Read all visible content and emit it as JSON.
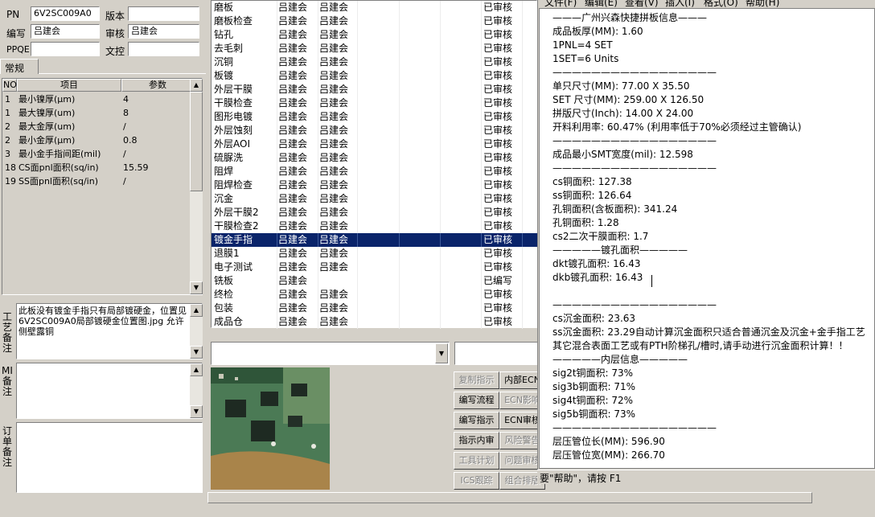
{
  "header": {
    "pn_label": "PN",
    "pn_value": "6V2SC009A0",
    "version_label": "版本",
    "version_value": "",
    "author_label": "编写",
    "author_value": "吕建会",
    "review_label": "审核",
    "review_value": "吕建会",
    "ppqe_label": "PPQE",
    "ppqe_value": "",
    "doc_label": "文控",
    "doc_value": ""
  },
  "tab": {
    "label": "常规"
  },
  "params": {
    "col_no": "NO",
    "col_item": "项目",
    "col_value": "参数",
    "rows": [
      {
        "no": "1",
        "item": "最小镍厚(μm)",
        "value": "4"
      },
      {
        "no": "1",
        "item": "最大镍厚(um)",
        "value": "8"
      },
      {
        "no": "2",
        "item": "最大金厚(um)",
        "value": "/"
      },
      {
        "no": "2",
        "item": "最小金厚(μm)",
        "value": "0.8"
      },
      {
        "no": "3",
        "item": "最小金手指间距(mil)",
        "value": "/"
      },
      {
        "no": "18",
        "item": "CS面pnl面积(sq/in)",
        "value": "15.59"
      },
      {
        "no": "19",
        "item": "SS面pnl面积(sq/in)",
        "value": "/"
      }
    ]
  },
  "notes": {
    "process_label": "工艺备注",
    "process_text": "此板没有镀金手指只有局部镀硬金，位置见6V2SC009A0局部镀硬金位置图.jpg 允许侧壁露铜",
    "mi_label": "MI备注",
    "mi_text": "",
    "order_label": "订单备注",
    "order_text": ""
  },
  "process": {
    "rows": [
      {
        "name": "磨板",
        "writer": "吕建会",
        "reviewer": "吕建会",
        "status": "已审核",
        "selected": false
      },
      {
        "name": "磨板检查",
        "writer": "吕建会",
        "reviewer": "吕建会",
        "status": "已审核",
        "selected": false
      },
      {
        "name": "钻孔",
        "writer": "吕建会",
        "reviewer": "吕建会",
        "status": "已审核",
        "selected": false
      },
      {
        "name": "去毛刺",
        "writer": "吕建会",
        "reviewer": "吕建会",
        "status": "已审核",
        "selected": false
      },
      {
        "name": "沉铜",
        "writer": "吕建会",
        "reviewer": "吕建会",
        "status": "已审核",
        "selected": false
      },
      {
        "name": "板镀",
        "writer": "吕建会",
        "reviewer": "吕建会",
        "status": "已审核",
        "selected": false
      },
      {
        "name": "外层干膜",
        "writer": "吕建会",
        "reviewer": "吕建会",
        "status": "已审核",
        "selected": false
      },
      {
        "name": "干膜检查",
        "writer": "吕建会",
        "reviewer": "吕建会",
        "status": "已审核",
        "selected": false
      },
      {
        "name": "图形电镀",
        "writer": "吕建会",
        "reviewer": "吕建会",
        "status": "已审核",
        "selected": false
      },
      {
        "name": "外层蚀刻",
        "writer": "吕建会",
        "reviewer": "吕建会",
        "status": "已审核",
        "selected": false
      },
      {
        "name": "外层AOI",
        "writer": "吕建会",
        "reviewer": "吕建会",
        "status": "已审核",
        "selected": false
      },
      {
        "name": "硫脲洗",
        "writer": "吕建会",
        "reviewer": "吕建会",
        "status": "已审核",
        "selected": false
      },
      {
        "name": "阻焊",
        "writer": "吕建会",
        "reviewer": "吕建会",
        "status": "已审核",
        "selected": false
      },
      {
        "name": "阻焊检查",
        "writer": "吕建会",
        "reviewer": "吕建会",
        "status": "已审核",
        "selected": false
      },
      {
        "name": "沉金",
        "writer": "吕建会",
        "reviewer": "吕建会",
        "status": "已审核",
        "selected": false
      },
      {
        "name": "外层干膜2",
        "writer": "吕建会",
        "reviewer": "吕建会",
        "status": "已审核",
        "selected": false
      },
      {
        "name": "干膜检查2",
        "writer": "吕建会",
        "reviewer": "吕建会",
        "status": "已审核",
        "selected": false
      },
      {
        "name": "镀金手指",
        "writer": "吕建会",
        "reviewer": "吕建会",
        "status": "已审核",
        "selected": true
      },
      {
        "name": "退膜1",
        "writer": "吕建会",
        "reviewer": "吕建会",
        "status": "已审核",
        "selected": false
      },
      {
        "name": "电子测试",
        "writer": "吕建会",
        "reviewer": "吕建会",
        "status": "已审核",
        "selected": false
      },
      {
        "name": "铣板",
        "writer": "吕建会",
        "reviewer": "",
        "status": "已编写",
        "selected": false
      },
      {
        "name": "终检",
        "writer": "吕建会",
        "reviewer": "吕建会",
        "status": "已审核",
        "selected": false
      },
      {
        "name": "包装",
        "writer": "吕建会",
        "reviewer": "吕建会",
        "status": "已审核",
        "selected": false
      },
      {
        "name": "成品仓",
        "writer": "吕建会",
        "reviewer": "吕建会",
        "status": "已审核",
        "selected": false
      }
    ]
  },
  "buttons": {
    "b1": "复制指示",
    "b2": "内部ECN",
    "b3": "编写流程",
    "b4": "ECN影响",
    "b5": "编写指示",
    "b6": "ECN审核",
    "b7": "指示内审",
    "b8": "风险警告",
    "b9": "工具计划",
    "b10": "问题审核",
    "b11": "ICS跟踪",
    "b12": "组合排版"
  },
  "menu": {
    "file": "文件(F)",
    "edit": "编辑(E)",
    "view": "查看(V)",
    "insert": "插入(I)",
    "format": "格式(O)",
    "help": "帮助(H)"
  },
  "info": {
    "lines": [
      "———广州兴森快捷拼板信息———",
      "成品板厚(MM): 1.60",
      "1PNL=4 SET",
      "1SET=6 Units",
      "—————————————————",
      "单只尺寸(MM): 77.00 X 35.50",
      "SET 尺寸(MM): 259.00 X 126.50",
      "拼版尺寸(Inch): 14.00 X 24.00",
      "开料利用率: 60.47% (利用率低于70%必须经过主管确认)",
      "—————————————————",
      "成品最小SMT宽度(mil): 12.598",
      "—————————————————",
      "cs铜面积: 127.38",
      "ss铜面积: 126.64",
      "孔铜面积(含板面积): 341.24",
      "孔铜面积: 1.28",
      "cs2二次干膜面积: 1.7",
      "—————镀孔面积—————",
      "dkt镀孔面积: 16.43",
      "dkb镀孔面积: 16.43",
      "",
      "—————————————————",
      "cs沉金面积: 23.63",
      "ss沉金面积: 23.29自动计算沉金面积只适合普通沉金及沉金+金手指工艺",
      "其它混合表面工艺或有PTH阶梯孔/槽时,请手动进行沉金面积计算！！",
      "—————内层信息—————",
      "sig2t铜面积: 73%",
      "sig3b铜面积: 71%",
      "sig4t铜面积: 72%",
      "sig5b铜面积: 73%",
      "—————————————————",
      "层压管位长(MM): 596.90",
      "层压管位宽(MM): 266.70"
    ]
  },
  "status_bar": {
    "text": "要\"帮助\"，请按 F1"
  }
}
